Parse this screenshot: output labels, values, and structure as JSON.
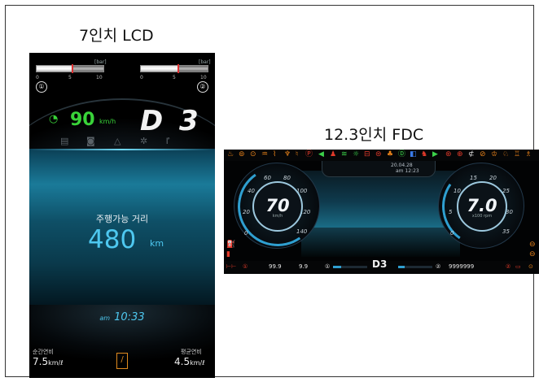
{
  "captions": {
    "lcd": "7인치 LCD",
    "fdc": "12.3인치 FDC"
  },
  "lcd": {
    "gauge1": {
      "unit": "[bar]",
      "ticks": [
        "0",
        "5",
        "10"
      ],
      "badge": "①",
      "value": 5.2
    },
    "gauge2": {
      "unit": "[bar]",
      "ticks": [
        "0",
        "5",
        "10"
      ],
      "badge": "②",
      "value": 5.5
    },
    "speed": {
      "value": "90",
      "unit": "km/h",
      "icon": "speedometer-icon"
    },
    "gear": "D 3",
    "warnings": [
      "fuel-filter-icon",
      "seatbelt-icon",
      "warning-triangle-icon",
      "gear-warning-icon",
      "wrench-icon"
    ],
    "range": {
      "label": "주행가능 거리",
      "value": "480",
      "unit": "km"
    },
    "clock": {
      "ampm": "am",
      "time": "10:33"
    },
    "instant_fuel": {
      "label": "순간연비",
      "value": "7.5",
      "unit": "km/ℓ"
    },
    "average_fuel": {
      "label": "평균연비",
      "value": "4.5",
      "unit": "km/ℓ"
    },
    "lane_icon": "lane-departure-icon",
    "colors": {
      "speed": "#39d339",
      "accent": "#4ec8f0",
      "lane": "#e08a1e",
      "gauge_mark": "#e03030"
    }
  },
  "fdc": {
    "date": "20.04.28",
    "time": "am 12:23",
    "speed_dial": {
      "value": "70",
      "unit": "km/h",
      "ticks": [
        "20",
        "40",
        "60",
        "80",
        "100",
        "120",
        "140",
        "0"
      ]
    },
    "rpm_dial": {
      "value": "7.0",
      "unit": "x100 rpm",
      "ticks": [
        "5",
        "10",
        "15",
        "20",
        "25",
        "30",
        "35",
        "0"
      ]
    },
    "gear": "D3",
    "trip1": "99.9",
    "trip2": "9.9",
    "odometer": "9999999",
    "badge1": "①",
    "badge2": "②",
    "colors": {
      "accent": "#2f9fd0",
      "warning_orange": "#e8821a",
      "warning_red": "#e23a2a",
      "indicator_green": "#3cd24a",
      "indicator_blue": "#3a7ae8"
    }
  }
}
